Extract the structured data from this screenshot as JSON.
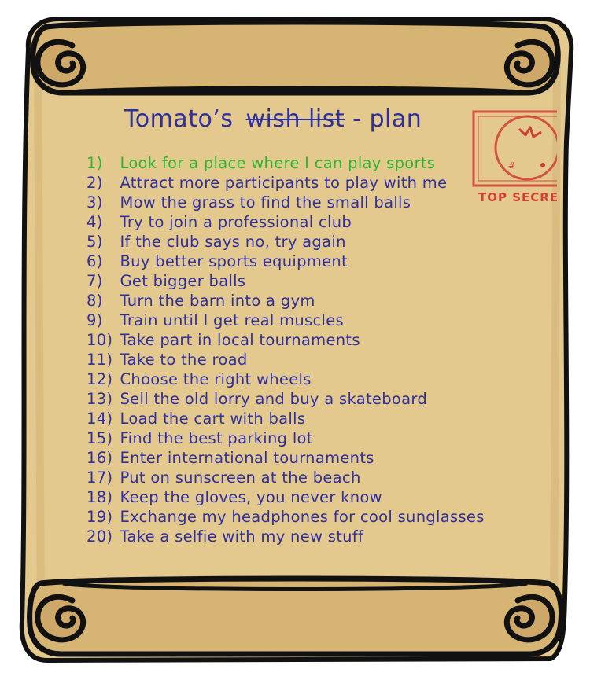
{
  "header": {
    "owner": "Tomato’s",
    "struck_text": "wish list",
    "suffix": "- plan"
  },
  "stamp": {
    "text": "TOP SECRE",
    "color": "#cf3f33"
  },
  "colors": {
    "parchment": "#e3c98e",
    "ink": "#2f2f9e",
    "done": "#2fb62f",
    "outline": "#111111"
  },
  "tasks": [
    {
      "num": "1)",
      "text": "Look for a place where I can play sports",
      "status": "done"
    },
    {
      "num": "2)",
      "text": "Attract more participants to play with me",
      "status": "todo"
    },
    {
      "num": "3)",
      "text": "Mow the grass to find the small balls",
      "status": "todo"
    },
    {
      "num": "4)",
      "text": "Try to join a professional club",
      "status": "todo"
    },
    {
      "num": "5)",
      "text": "If the club says no, try again",
      "status": "todo"
    },
    {
      "num": "6)",
      "text": "Buy better sports equipment",
      "status": "todo"
    },
    {
      "num": "7)",
      "text": "Get bigger balls",
      "status": "todo"
    },
    {
      "num": "8)",
      "text": "Turn the barn into a gym",
      "status": "todo"
    },
    {
      "num": "9)",
      "text": "Train until I get real muscles",
      "status": "todo"
    },
    {
      "num": "10)",
      "text": "Take part in local tournaments",
      "status": "todo"
    },
    {
      "num": "11)",
      "text": "Take to the road",
      "status": "todo"
    },
    {
      "num": "12)",
      "text": "Choose the right wheels",
      "status": "todo"
    },
    {
      "num": "13)",
      "text": "Sell the old lorry and buy a skateboard",
      "status": "todo"
    },
    {
      "num": "14)",
      "text": "Load the cart with balls",
      "status": "todo"
    },
    {
      "num": "15)",
      "text": "Find the best parking lot",
      "status": "todo"
    },
    {
      "num": "16)",
      "text": "Enter international tournaments",
      "status": "todo"
    },
    {
      "num": "17)",
      "text": "Put on sunscreen at the beach",
      "status": "todo"
    },
    {
      "num": "18)",
      "text": "Keep the gloves, you never know",
      "status": "todo"
    },
    {
      "num": "19)",
      "text": "Exchange my headphones for cool sunglasses",
      "status": "todo"
    },
    {
      "num": "20)",
      "text": "Take a selfie with my new stuff",
      "status": "todo"
    }
  ]
}
